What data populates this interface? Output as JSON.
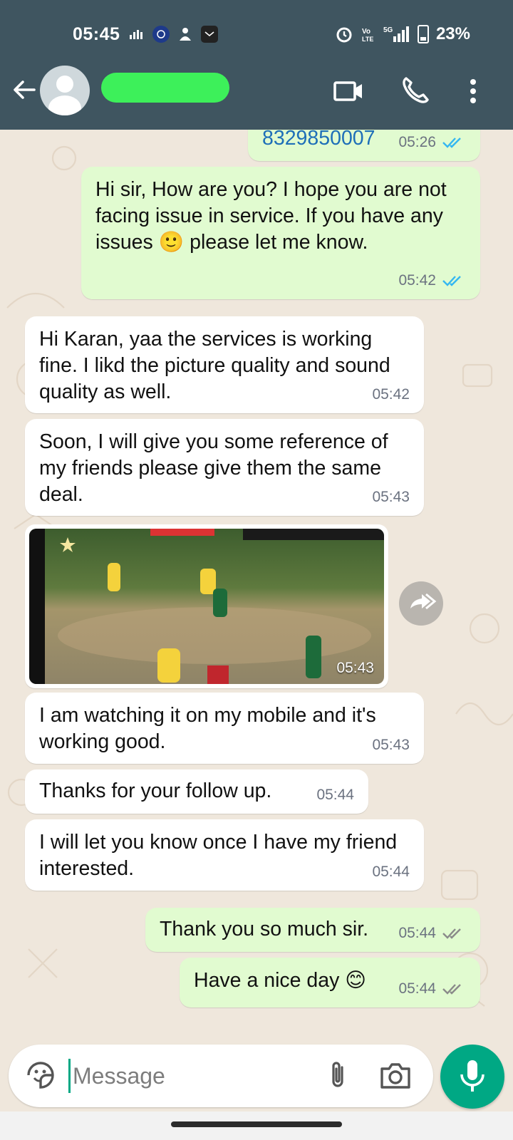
{
  "status_bar": {
    "time": "05:45",
    "network": "5G",
    "battery": "23%"
  },
  "contact": {
    "name": ""
  },
  "messages": [
    {
      "id": "m0",
      "dir": "out",
      "text": "8329850007",
      "time": "05:26",
      "status": "read"
    },
    {
      "id": "m1",
      "dir": "out",
      "text": "Hi sir, How are you? I hope you are not facing issue in service. If you have any issues 🙂 please let me know.",
      "time": "05:42",
      "status": "read"
    },
    {
      "id": "m2",
      "dir": "in",
      "text": "Hi Karan, yaa the services is working fine. I likd the picture quality and sound quality as well.",
      "time": "05:42"
    },
    {
      "id": "m3",
      "dir": "in",
      "text": "Soon, I will give you some reference of my friends please give them the same deal.",
      "time": "05:43"
    },
    {
      "id": "m4",
      "dir": "in",
      "type": "video",
      "time": "05:43"
    },
    {
      "id": "m5",
      "dir": "in",
      "text": "I am watching it on my mobile and it's working good.",
      "time": "05:43"
    },
    {
      "id": "m6",
      "dir": "in",
      "text": "Thanks for your follow up.",
      "time": "05:44"
    },
    {
      "id": "m7",
      "dir": "in",
      "text": "I will let you know once I have my friend interested.",
      "time": "05:44"
    },
    {
      "id": "m8",
      "dir": "out",
      "text": "Thank you so much sir.",
      "time": "05:44",
      "status": "delivered"
    },
    {
      "id": "m9",
      "dir": "out",
      "text": "Have a nice day 😊",
      "time": "05:44",
      "status": "delivered"
    }
  ],
  "composer": {
    "placeholder": "Message"
  },
  "colors": {
    "header": "#3f5560",
    "outgoing": "#e1fbd0",
    "incoming": "#ffffff",
    "accent": "#00a884",
    "read_tick": "#34b7f1"
  },
  "icons": [
    "back-arrow-icon",
    "video-call-icon",
    "phone-icon",
    "more-vert-icon",
    "forward-icon",
    "sticker-icon",
    "attach-icon",
    "camera-icon",
    "mic-icon"
  ]
}
